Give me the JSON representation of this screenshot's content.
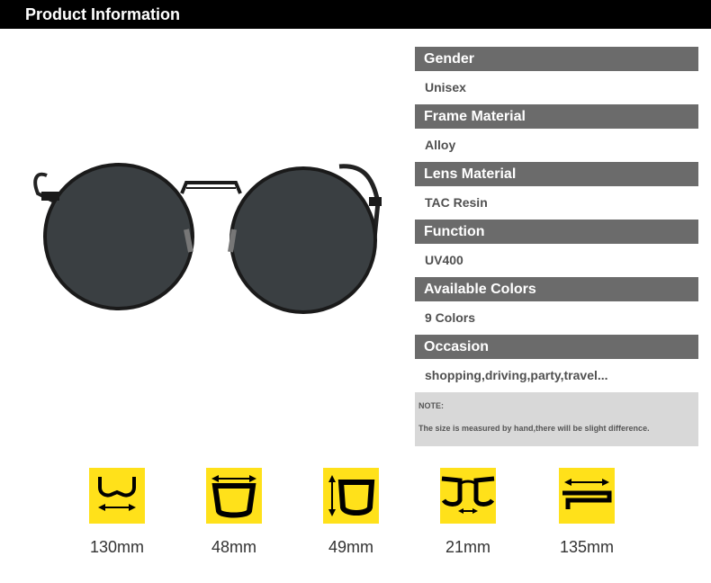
{
  "header": {
    "title": "Product Information"
  },
  "specs": [
    {
      "label": "Gender",
      "value": "Unisex"
    },
    {
      "label": "Frame Material",
      "value": "Alloy"
    },
    {
      "label": "Lens Material",
      "value": "TAC Resin"
    },
    {
      "label": "Function",
      "value": "UV400"
    },
    {
      "label": "Available Colors",
      "value": "9 Colors"
    },
    {
      "label": "Occasion",
      "value": "shopping,driving,party,travel..."
    }
  ],
  "note": {
    "title": "NOTE:",
    "text": "The size is measured by hand,there will be slight difference."
  },
  "measurements": [
    {
      "value": "130mm",
      "icon": "frame-width-icon"
    },
    {
      "value": "48mm",
      "icon": "lens-width-icon"
    },
    {
      "value": "49mm",
      "icon": "lens-height-icon"
    },
    {
      "value": "21mm",
      "icon": "bridge-width-icon"
    },
    {
      "value": "135mm",
      "icon": "temple-length-icon"
    }
  ],
  "colors": {
    "header": "#000000",
    "label_bg": "#6b6b6b",
    "note_bg": "#d8d8d8",
    "icon_bg": "#ffe11a"
  }
}
